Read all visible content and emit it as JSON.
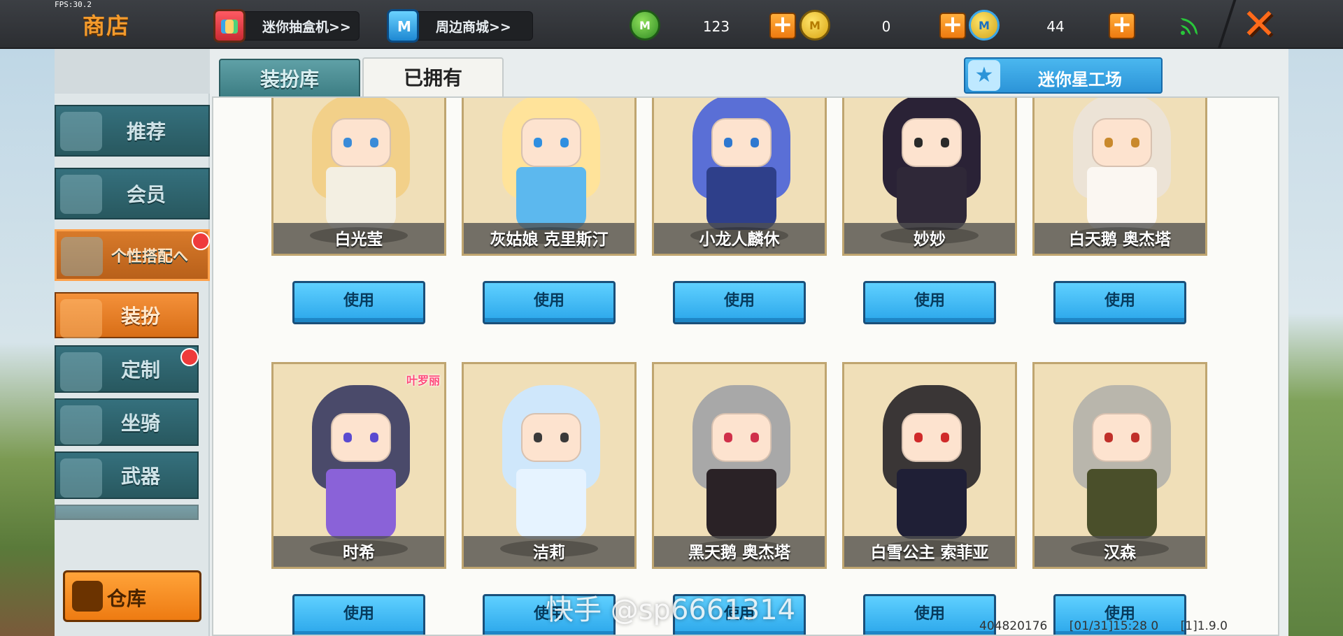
{
  "fps": "FPS:30.2",
  "header": {
    "title": "商店",
    "gacha_label": "迷你抽盒机>>",
    "mall_label": "周边商城>>",
    "currencies": [
      {
        "icon": "green-coin-icon",
        "symbol": "M",
        "value": "123"
      },
      {
        "icon": "gold-coin-icon",
        "symbol": "M",
        "value": "0"
      },
      {
        "icon": "star-coin-icon",
        "symbol": "M",
        "value": "44"
      }
    ],
    "plus": "+",
    "close": "✕"
  },
  "tabs": {
    "library": "装扮库",
    "owned": "已拥有"
  },
  "workshop": {
    "label": "迷你星工场",
    "icon": "★"
  },
  "sidebar": {
    "items": [
      {
        "label": "推荐"
      },
      {
        "label": "会员"
      },
      {
        "label": "个性搭配へ"
      },
      {
        "label": "装扮"
      },
      {
        "label": "定制"
      },
      {
        "label": "坐骑"
      },
      {
        "label": "武器"
      }
    ],
    "warehouse": "仓库"
  },
  "skins": [
    {
      "name": "白光莹",
      "hair": "#f2d089",
      "eye": "#3a8bd8",
      "body": "#f3efe2"
    },
    {
      "name": "灰姑娘 克里斯汀",
      "hair": "#ffe39a",
      "eye": "#2f8fe0",
      "body": "#5cb8ee"
    },
    {
      "name": "小龙人麟休",
      "hair": "#5a6fd6",
      "eye": "#2e78d0",
      "body": "#2e3f8a"
    },
    {
      "name": "妙妙",
      "hair": "#2a2236",
      "eye": "#2a2a2a",
      "body": "#2f2838"
    },
    {
      "name": "白天鹅 奥杰塔",
      "hair": "#ece3d6",
      "eye": "#c9892c",
      "body": "#fbf7f2"
    },
    {
      "name": "时希",
      "hair": "#4a4a6a",
      "eye": "#5a4ad0",
      "body": "#8a62d8",
      "badge": "叶罗丽"
    },
    {
      "name": "洁莉",
      "hair": "#cfe7fb",
      "eye": "#3a3a3a",
      "body": "#e6f3ff"
    },
    {
      "name": "黑天鹅 奥杰塔",
      "hair": "#a8a8a8",
      "eye": "#d0304a",
      "body": "#2a2226"
    },
    {
      "name": "白雪公主 索菲亚",
      "hair": "#3a3636",
      "eye": "#d02a2a",
      "body": "#1f1f36"
    },
    {
      "name": "汉森",
      "hair": "#b9b6ac",
      "eye": "#c0302a",
      "body": "#4a4f2a"
    }
  ],
  "use_label": "使用",
  "watermark": "快手 @sp6661314",
  "footer": {
    "id": "404820176",
    "time": "[01/31]15:28 0",
    "version": "[1]1.9.0"
  }
}
